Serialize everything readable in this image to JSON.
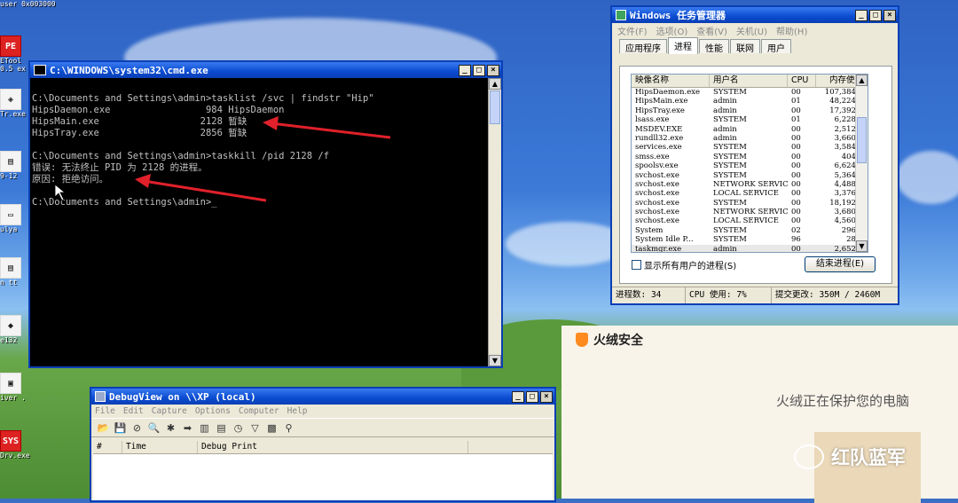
{
  "colors": {
    "xp_title": "#0a4bd0",
    "console_bg": "#000000",
    "annotation_arrow": "#e0202a",
    "huorong_orange": "#ff8a1d"
  },
  "desktop": {
    "top_strip": "user       0x003000",
    "icons": [
      {
        "glyph": "PE",
        "label": "ETool\n0.5 ex",
        "icon": "pe-tool-icon",
        "red": true
      },
      {
        "glyph": "◈",
        "label": "Tr.exe",
        "icon": "gear-shield-icon",
        "red": false
      },
      {
        "glyph": "▤",
        "label": "9-12",
        "icon": "document-icon",
        "red": false
      },
      {
        "glyph": "▭",
        "label": "ulya",
        "icon": "window-icon",
        "red": false
      },
      {
        "glyph": "▤",
        "label": "n tt",
        "icon": "document-icon",
        "red": false
      },
      {
        "glyph": "◆",
        "label": "e132",
        "icon": "app-icon",
        "red": false
      },
      {
        "glyph": "▣",
        "label": "iver .",
        "icon": "driver-icon",
        "red": false
      },
      {
        "glyph": "SYS",
        "label": "Drv.exe",
        "icon": "sys-driver-icon",
        "red": true
      }
    ]
  },
  "cmd": {
    "title": "C:\\WINDOWS\\system32\\cmd.exe",
    "lines": [
      "",
      "C:\\Documents and Settings\\admin>tasklist /svc | findstr \"Hip\"",
      "HipsDaemon.exe                 984 HipsDaemon",
      "HipsMain.exe                  2128 暂缺",
      "HipsTray.exe                  2856 暂缺",
      "",
      "C:\\Documents and Settings\\admin>taskkill /pid 2128 /f",
      "错误: 无法终止 PID 为 2128 的进程。",
      "原因: 拒绝访问。",
      "",
      "C:\\Documents and Settings\\admin>_"
    ]
  },
  "taskmgr": {
    "title": "Windows 任务管理器",
    "menu": [
      "文件(F)",
      "选项(O)",
      "查看(V)",
      "关机(U)",
      "帮助(H)"
    ],
    "tabs": [
      "应用程序",
      "进程",
      "性能",
      "联网",
      "用户"
    ],
    "active_tab": 1,
    "columns": [
      "映像名称",
      "用户名",
      "CPU",
      "内存使用"
    ],
    "rows": [
      [
        "HipsDaemon.exe",
        "SYSTEM",
        "00",
        "107,384 K"
      ],
      [
        "HipsMain.exe",
        "admin",
        "01",
        "48,224 K"
      ],
      [
        "HipsTray.exe",
        "admin",
        "00",
        "17,392 K"
      ],
      [
        "lsass.exe",
        "SYSTEM",
        "01",
        "6,228 K"
      ],
      [
        "MSDEV.EXE",
        "admin",
        "00",
        "2,512 K"
      ],
      [
        "rundll32.exe",
        "admin",
        "00",
        "3,660 K"
      ],
      [
        "services.exe",
        "SYSTEM",
        "00",
        "3,584 K"
      ],
      [
        "smss.exe",
        "SYSTEM",
        "00",
        "404 K"
      ],
      [
        "spoolsv.exe",
        "SYSTEM",
        "00",
        "6,624 K"
      ],
      [
        "svchost.exe",
        "SYSTEM",
        "00",
        "5,364 K"
      ],
      [
        "svchost.exe",
        "NETWORK SERVICE",
        "00",
        "4,488 K"
      ],
      [
        "svchost.exe",
        "LOCAL SERVICE",
        "00",
        "3,376 K"
      ],
      [
        "svchost.exe",
        "SYSTEM",
        "00",
        "18,192 K"
      ],
      [
        "svchost.exe",
        "NETWORK SERVICE",
        "00",
        "3,680 K"
      ],
      [
        "svchost.exe",
        "LOCAL SERVICE",
        "00",
        "4,560 K"
      ],
      [
        "System",
        "SYSTEM",
        "02",
        "296 K"
      ],
      [
        "System Idle P...",
        "SYSTEM",
        "96",
        "28 K"
      ],
      [
        "taskmgr.exe",
        "admin",
        "00",
        "2,652 K"
      ]
    ],
    "show_all_label": "显示所有用户的进程(S)",
    "end_process_label": "结束进程(E)",
    "status_procs": "进程数: 34",
    "status_cpu": "CPU 使用: 7%",
    "status_commit": "提交更改: 350M / 2460M"
  },
  "debugview": {
    "title": "DebugView on \\\\XP (local)",
    "menu": [
      "File",
      "Edit",
      "Capture",
      "Options",
      "Computer",
      "Help"
    ],
    "toolbar": [
      "open-icon",
      "save-icon",
      "clear-icon",
      "find-icon",
      "capture-icon",
      "autoscroll-icon",
      "filter-icon",
      "history-icon",
      "clock-icon",
      "highlight-icon",
      "properties-icon",
      "binoculars-icon"
    ],
    "columns": [
      "#",
      "Time",
      "Debug Print"
    ]
  },
  "huorong": {
    "brand": "火绒安全",
    "protect_text": "火绒正在保护您的电脑",
    "watermark": "红队蓝军"
  }
}
